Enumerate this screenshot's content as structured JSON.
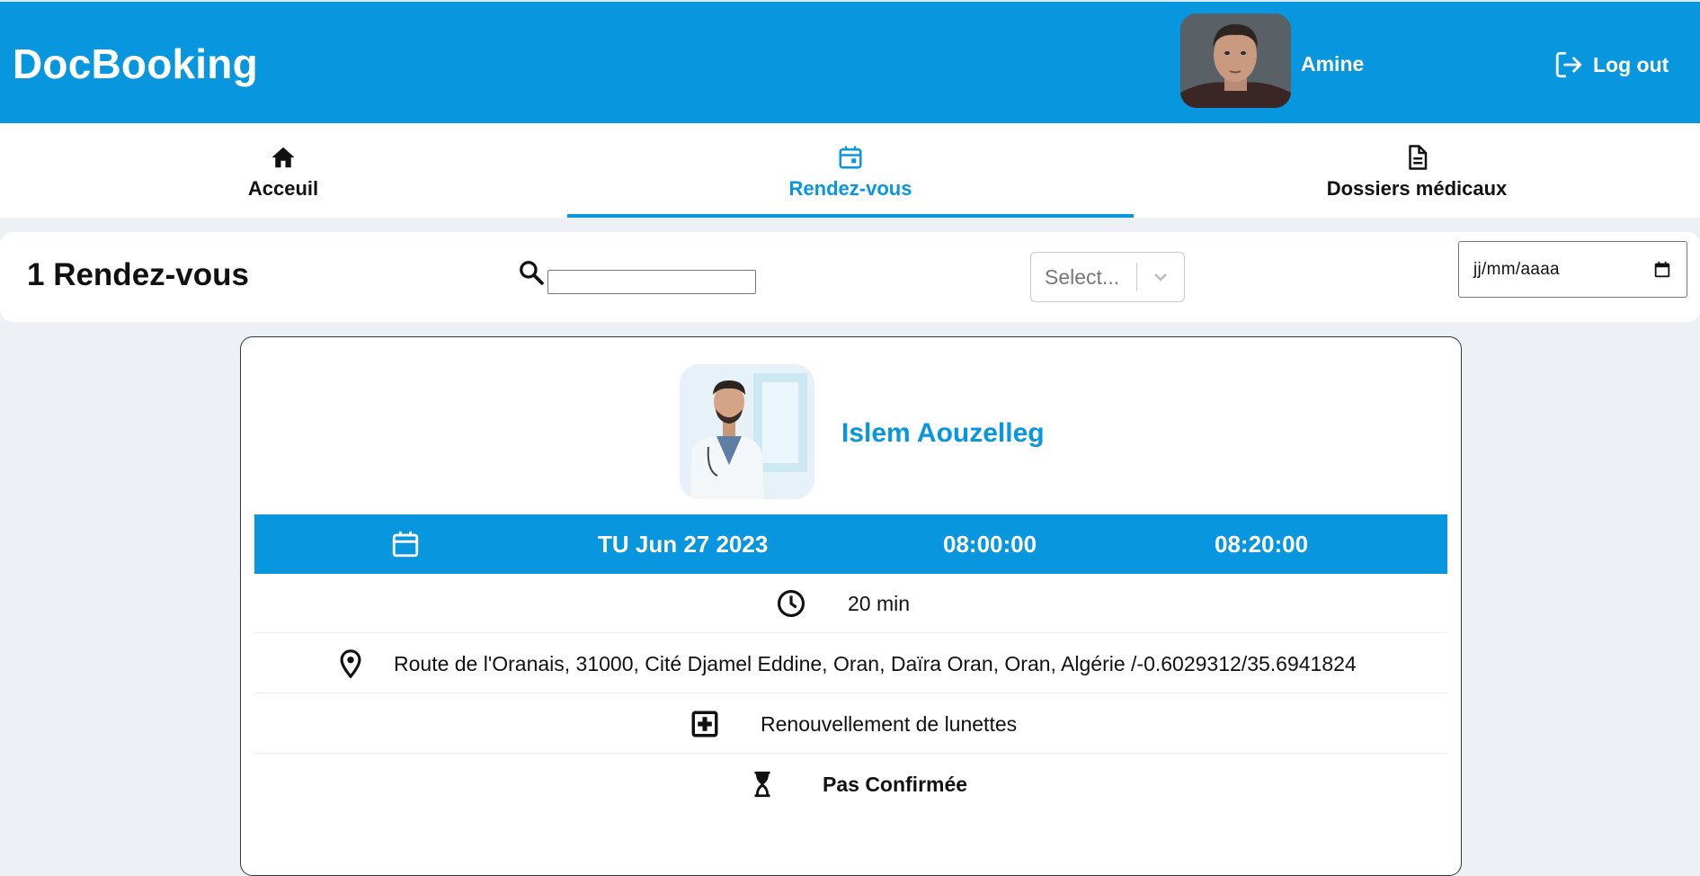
{
  "header": {
    "brand": "DocBooking",
    "user_name": "Amine",
    "logout_label": "Log out"
  },
  "nav": {
    "tabs": [
      {
        "label": "Acceuil",
        "icon": "home-icon",
        "active": false
      },
      {
        "label": "Rendez-vous",
        "icon": "calendar-icon",
        "active": true
      },
      {
        "label": "Dossiers médicaux",
        "icon": "document-icon",
        "active": false
      }
    ]
  },
  "filters": {
    "count_title": "1 Rendez-vous",
    "search_value": "",
    "select_placeholder": "Select...",
    "date_placeholder": "jj/mm/aaaa"
  },
  "appointment": {
    "doctor_name": "Islem Aouzelleg",
    "date": "TU Jun 27 2023",
    "start_time": "08:00:00",
    "end_time": "08:20:00",
    "duration": "20 min",
    "address": "Route de l'Oranais, 31000, Cité Djamel Eddine, Oran, Daïra Oran, Oran, Algérie /-0.6029312/35.6941824",
    "reason": "Renouvellement de lunettes",
    "status": "Pas Confirmée"
  },
  "colors": {
    "primary": "#0896df",
    "background": "#edf0f4",
    "text": "#111111"
  }
}
